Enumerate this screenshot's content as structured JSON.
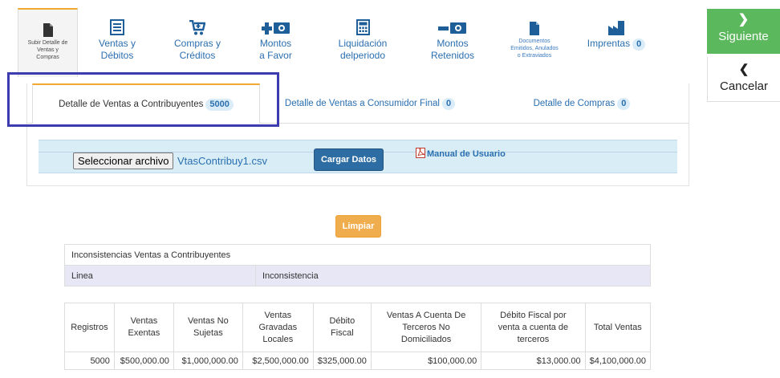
{
  "toolbar": {
    "items": [
      {
        "label": "Subir Detalle de\nVentas y\nCompras",
        "icon": "file-icon"
      },
      {
        "label": "Ventas y\nDébitos",
        "icon": "ledger-icon"
      },
      {
        "label": "Compras y\nCréditos",
        "icon": "cart-icon"
      },
      {
        "label": "Montos\na Favor",
        "icon": "plus-money-icon"
      },
      {
        "label": "Liquidación\ndelperiodo",
        "icon": "calculator-icon"
      },
      {
        "label": "Montos\nRetenidos",
        "icon": "minus-money-icon"
      },
      {
        "label": "Documentos\nEmitidos, Anulados\no Extraviados",
        "icon": "document-icon"
      },
      {
        "label": "Imprentas",
        "icon": "factory-icon",
        "badge": "0"
      }
    ]
  },
  "actions": {
    "next_label": "Siguiente",
    "cancel_label": "Cancelar"
  },
  "tabs": [
    {
      "label": "Detalle de Ventas a Contribuyentes",
      "badge": "5000"
    },
    {
      "label": "Detalle de Ventas a Consumidor Final",
      "badge": "0"
    },
    {
      "label": "Detalle de Compras",
      "badge": "0"
    }
  ],
  "upload": {
    "file_button": "Seleccionar archivo",
    "file_name": "VtasContribuy1.csv",
    "load_button": "Cargar Datos",
    "manual_link": "Manual de Usuario"
  },
  "clear_button": "Limpiar",
  "inconsistencies": {
    "title": "Inconsistencias Ventas a Contribuyentes",
    "col_line": "Linea",
    "col_issue": "Inconsistencia"
  },
  "summary": {
    "headers": [
      "Registros",
      "Ventas\nExentas",
      "Ventas No\nSujetas",
      "Ventas\nGravadas\nLocales",
      "Débito\nFiscal",
      "Ventas A Cuenta De\nTerceros No\nDomiciliados",
      "Débito Fiscal por\nventa a cuenta de\nterceros",
      "Total Ventas"
    ],
    "row": [
      "5000",
      "$500,000.00",
      "$1,000,000.00",
      "$2,500,000.00",
      "$325,000.00",
      "$100,000.00",
      "$13,000.00",
      "$4,100,000.00"
    ]
  },
  "colors": {
    "accent_blue": "#2a6fb0",
    "success": "#5cb85c",
    "warning": "#f0ad4e",
    "primary_btn": "#2d6da3",
    "highlight": "#3c3cb0"
  }
}
